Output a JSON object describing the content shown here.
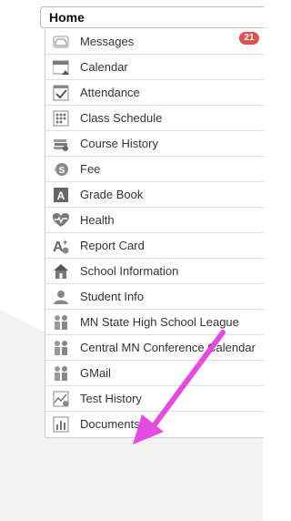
{
  "header": {
    "title": "Home"
  },
  "menu": {
    "items": [
      {
        "label": "Messages",
        "icon": "messages-icon",
        "badge": "21"
      },
      {
        "label": "Calendar",
        "icon": "calendar-icon"
      },
      {
        "label": "Attendance",
        "icon": "attendance-icon"
      },
      {
        "label": "Class Schedule",
        "icon": "class-schedule-icon"
      },
      {
        "label": "Course History",
        "icon": "course-history-icon"
      },
      {
        "label": "Fee",
        "icon": "fee-icon"
      },
      {
        "label": "Grade Book",
        "icon": "grade-book-icon"
      },
      {
        "label": "Health",
        "icon": "health-icon"
      },
      {
        "label": "Report Card",
        "icon": "report-card-icon"
      },
      {
        "label": "School Information",
        "icon": "school-information-icon"
      },
      {
        "label": "Student Info",
        "icon": "student-info-icon"
      },
      {
        "label": "MN State High School League",
        "icon": "people-icon"
      },
      {
        "label": "Central MN Conference Calendar",
        "icon": "people-icon"
      },
      {
        "label": "GMail",
        "icon": "people-icon"
      },
      {
        "label": "Test History",
        "icon": "test-history-icon"
      },
      {
        "label": "Documents",
        "icon": "documents-icon"
      }
    ]
  },
  "annotation": {
    "arrow_color": "#e44be0",
    "badge_color": "#d9534f"
  }
}
